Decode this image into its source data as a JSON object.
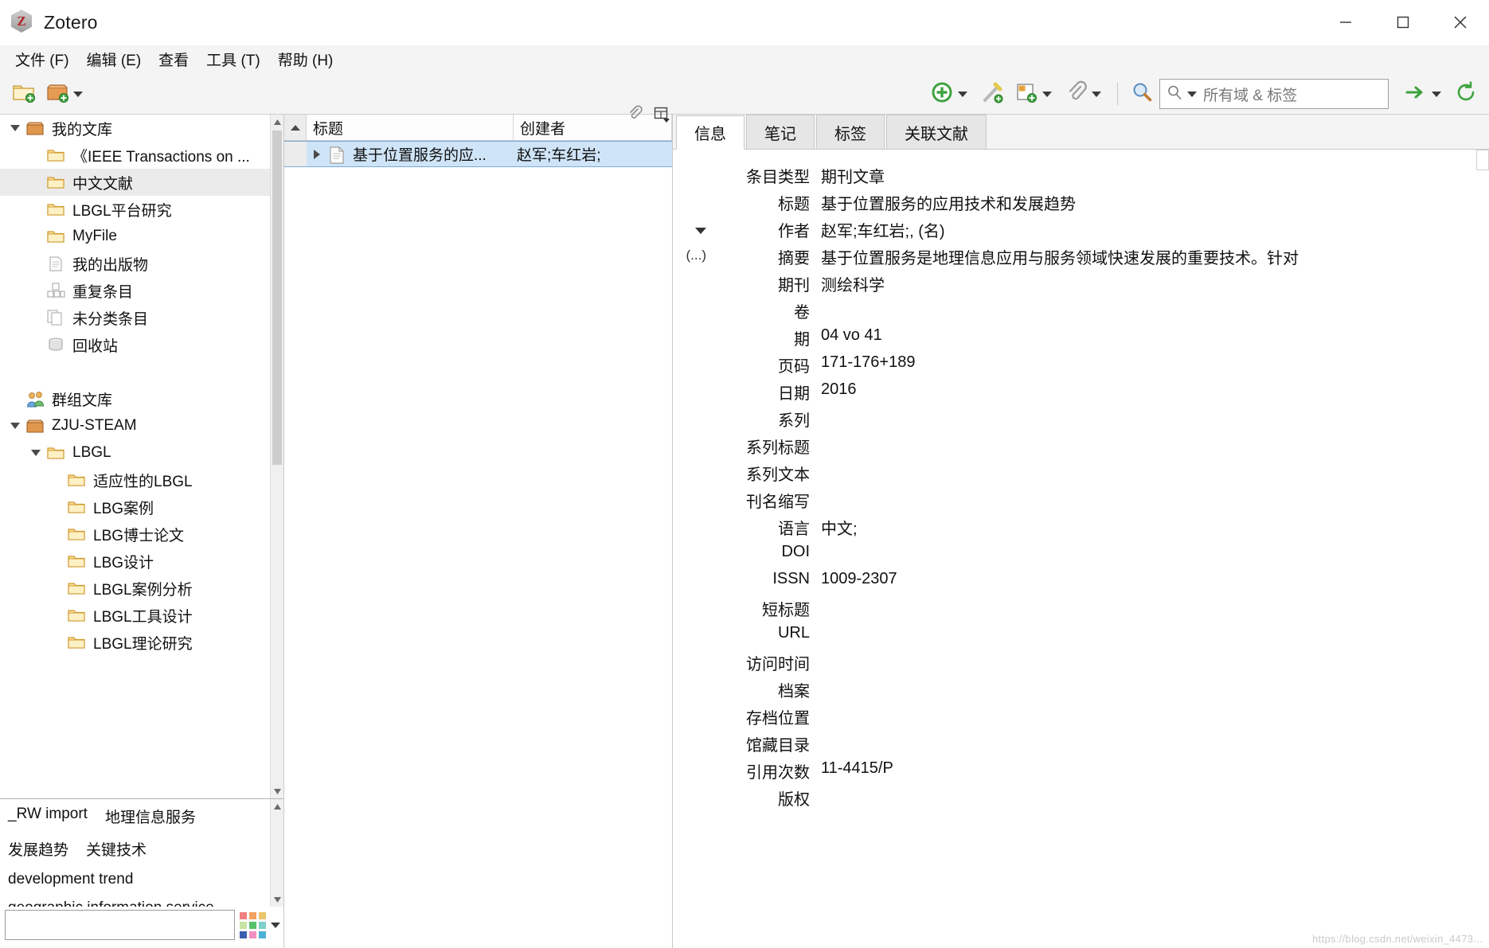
{
  "window": {
    "title": "Zotero",
    "app_icon": "zotero-logo-icon",
    "minimize_label": "—",
    "maximize_label": "□",
    "close_label": "✕"
  },
  "menubar": {
    "items": [
      {
        "label": "文件 (F)",
        "name": "menu-file"
      },
      {
        "label": "编辑 (E)",
        "name": "menu-edit"
      },
      {
        "label": "查看",
        "name": "menu-view"
      },
      {
        "label": "工具 (T)",
        "name": "menu-tools"
      },
      {
        "label": "帮助 (H)",
        "name": "menu-help"
      }
    ]
  },
  "toolbar": {
    "new_collection_icon": "new-collection-icon",
    "new_library_icon": "new-library-icon",
    "new_item_icon": "new-item-plus-icon",
    "add_by_identifier_icon": "magic-wand-icon",
    "new_note_icon": "new-note-icon",
    "add_attachment_icon": "paperclip-icon",
    "advanced_search_icon": "magnifier-icon",
    "locate_icon": "locate-arrow-icon",
    "sync_icon": "sync-refresh-icon",
    "search": {
      "placeholder": "所有域 & 标签",
      "value": "",
      "mode_icon": "search-small-icon"
    }
  },
  "sidebar": {
    "items": [
      {
        "label": "我的文库",
        "icon": "library-icon",
        "indent": 0,
        "twisty": "down",
        "selected": false
      },
      {
        "label": "《IEEE Transactions on ...",
        "icon": "folder-icon",
        "indent": 1,
        "twisty": "",
        "selected": false
      },
      {
        "label": "中文文献",
        "icon": "folder-icon",
        "indent": 1,
        "twisty": "",
        "selected": true
      },
      {
        "label": "LBGL平台研究",
        "icon": "folder-icon",
        "indent": 1,
        "twisty": "",
        "selected": false
      },
      {
        "label": "MyFile",
        "icon": "folder-icon",
        "indent": 1,
        "twisty": "",
        "selected": false
      },
      {
        "label": "我的出版物",
        "icon": "publications-icon",
        "indent": 1,
        "twisty": "",
        "selected": false
      },
      {
        "label": "重复条目",
        "icon": "duplicates-icon",
        "indent": 1,
        "twisty": "",
        "selected": false
      },
      {
        "label": "未分类条目",
        "icon": "unfiled-icon",
        "indent": 1,
        "twisty": "",
        "selected": false
      },
      {
        "label": "回收站",
        "icon": "trash-icon",
        "indent": 1,
        "twisty": "",
        "selected": false
      },
      {
        "label": "",
        "icon": "",
        "indent": 0,
        "twisty": "",
        "selected": false
      },
      {
        "label": "群组文库",
        "icon": "group-libraries-icon",
        "indent": 0,
        "twisty": "",
        "selected": false
      },
      {
        "label": "ZJU-STEAM",
        "icon": "library-icon",
        "indent": 0,
        "twisty": "down",
        "selected": false
      },
      {
        "label": "LBGL",
        "icon": "folder-icon",
        "indent": 1,
        "twisty": "down",
        "selected": false
      },
      {
        "label": "适应性的LBGL",
        "icon": "folder-icon",
        "indent": 2,
        "twisty": "",
        "selected": false
      },
      {
        "label": "LBG案例",
        "icon": "folder-icon",
        "indent": 2,
        "twisty": "",
        "selected": false
      },
      {
        "label": "LBG博士论文",
        "icon": "folder-icon",
        "indent": 2,
        "twisty": "",
        "selected": false
      },
      {
        "label": "LBG设计",
        "icon": "folder-icon",
        "indent": 2,
        "twisty": "",
        "selected": false
      },
      {
        "label": "LBGL案例分析",
        "icon": "folder-icon",
        "indent": 2,
        "twisty": "",
        "selected": false
      },
      {
        "label": "LBGL工具设计",
        "icon": "folder-icon",
        "indent": 2,
        "twisty": "",
        "selected": false
      },
      {
        "label": "LBGL理论研究",
        "icon": "folder-icon",
        "indent": 2,
        "twisty": "",
        "selected": false
      }
    ]
  },
  "tag_selector": {
    "rows": [
      [
        "_RW import",
        "地理信息服务"
      ],
      [
        "发展趋势",
        "关键技术"
      ],
      [
        "development trend"
      ],
      [
        "geographic information service"
      ]
    ],
    "filter_placeholder": "",
    "filter_value": "",
    "swatch_colors": [
      "#f08080",
      "#f4a261",
      "#e9c46a",
      "#c9e4a6",
      "#57c06b",
      "#7fd1c9",
      "#3b5fb0",
      "#f08fc0",
      "#4db1d6"
    ]
  },
  "item_list": {
    "columns": {
      "title": "标题",
      "creator": "创建者",
      "attachment_icon": "paperclip-column-icon",
      "picker_icon": "column-picker-icon"
    },
    "sort_indicator": "sort-ascending-icon",
    "rows": [
      {
        "title": "基于位置服务的应...",
        "creator": "赵军;车红岩;",
        "icon": "journal-article-icon",
        "expandable": true,
        "selected": true
      }
    ]
  },
  "right_panel": {
    "tabs": [
      {
        "label": "信息",
        "active": true
      },
      {
        "label": "笔记",
        "active": false
      },
      {
        "label": "标签",
        "active": false
      },
      {
        "label": "关联文献",
        "active": false
      }
    ],
    "fields": [
      {
        "prefix": "",
        "label": "条目类型",
        "value": "期刊文章"
      },
      {
        "prefix": "",
        "label": "标题",
        "value": "基于位置服务的应用技术和发展趋势"
      },
      {
        "prefix": "triangle",
        "label": "作者",
        "value": "赵军;车红岩;, (名)"
      },
      {
        "prefix": "(...)",
        "label": "摘要",
        "value": "基于位置服务是地理信息应用与服务领域快速发展的重要技术。针对"
      },
      {
        "prefix": "",
        "label": "期刊",
        "value": "测绘科学"
      },
      {
        "prefix": "",
        "label": "卷",
        "value": ""
      },
      {
        "prefix": "",
        "label": "期",
        "value": "04 vo 41"
      },
      {
        "prefix": "",
        "label": "页码",
        "value": "171-176+189"
      },
      {
        "prefix": "",
        "label": "日期",
        "value": "2016"
      },
      {
        "prefix": "",
        "label": "系列",
        "value": ""
      },
      {
        "prefix": "",
        "label": "系列标题",
        "value": ""
      },
      {
        "prefix": "",
        "label": "系列文本",
        "value": ""
      },
      {
        "prefix": "",
        "label": "刊名缩写",
        "value": ""
      },
      {
        "prefix": "",
        "label": "语言",
        "value": "中文;"
      },
      {
        "prefix": "",
        "label": "DOI",
        "value": ""
      },
      {
        "prefix": "",
        "label": "ISSN",
        "value": "1009-2307"
      },
      {
        "prefix": "",
        "label": "短标题",
        "value": ""
      },
      {
        "prefix": "",
        "label": "URL",
        "value": ""
      },
      {
        "prefix": "",
        "label": "访问时间",
        "value": ""
      },
      {
        "prefix": "",
        "label": "档案",
        "value": ""
      },
      {
        "prefix": "",
        "label": "存档位置",
        "value": ""
      },
      {
        "prefix": "",
        "label": "馆藏目录",
        "value": ""
      },
      {
        "prefix": "",
        "label": "引用次数",
        "value": "11-4415/P"
      },
      {
        "prefix": "",
        "label": "版权",
        "value": ""
      }
    ]
  },
  "watermark": {
    "text": "https://blog.csdn.net/weixin_4473..."
  },
  "colors": {
    "selection_blue": "#cfe4f7",
    "folder_yellow": "#f6d377",
    "toolbar_bg": "#f4f4f4",
    "accent_green": "#3fa23f"
  }
}
